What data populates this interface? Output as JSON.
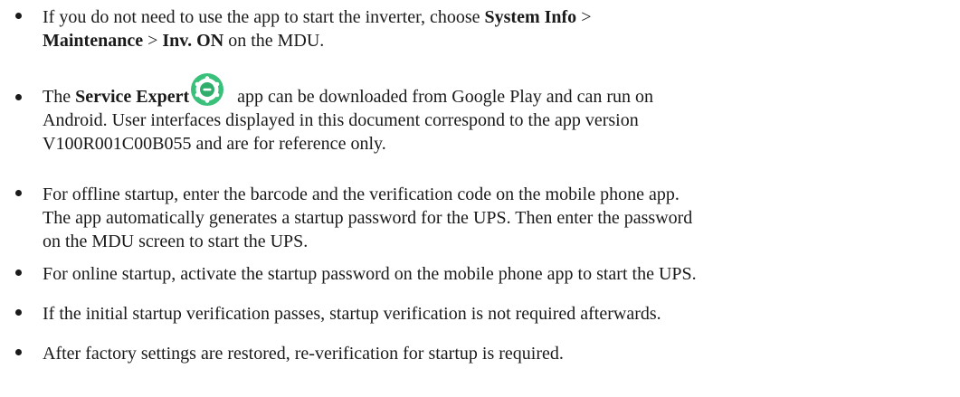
{
  "notes": [
    {
      "line1_pre": "If you do not need to use the app to start the inverter, choose ",
      "line1_b1": "System Info",
      "line1_post": " >",
      "line2_b1": "Maintenance",
      "line2_mid": " > ",
      "line2_b2": "Inv. ON",
      "line2_post": " on the MDU."
    },
    {
      "line1_pre": "The ",
      "line1_b1": "Service Expert",
      "app_icon": "service-expert-app-icon",
      "line1_post": "app can be downloaded from Google Play and can run on",
      "line2": "Android. User interfaces displayed in this document correspond to the app version",
      "line3": "V100R001C00B055 and are for reference only."
    },
    {
      "line1": "For offline startup, enter the barcode and the verification code on the mobile phone app.",
      "line2": "The app automatically generates a startup password for the UPS. Then enter the password",
      "line3": "on the MDU screen to start the UPS."
    },
    {
      "line1": "For online startup, activate the startup password on the mobile phone app to start the UPS."
    },
    {
      "line1": "If the initial startup verification passes, startup verification is not required afterwards."
    },
    {
      "line1": "After factory settings are restored, re-verification for startup is required."
    }
  ],
  "colors": {
    "text": "#1a1a1a",
    "icon_green": "#39c07a",
    "icon_dark_green": "#1f9d5c"
  }
}
